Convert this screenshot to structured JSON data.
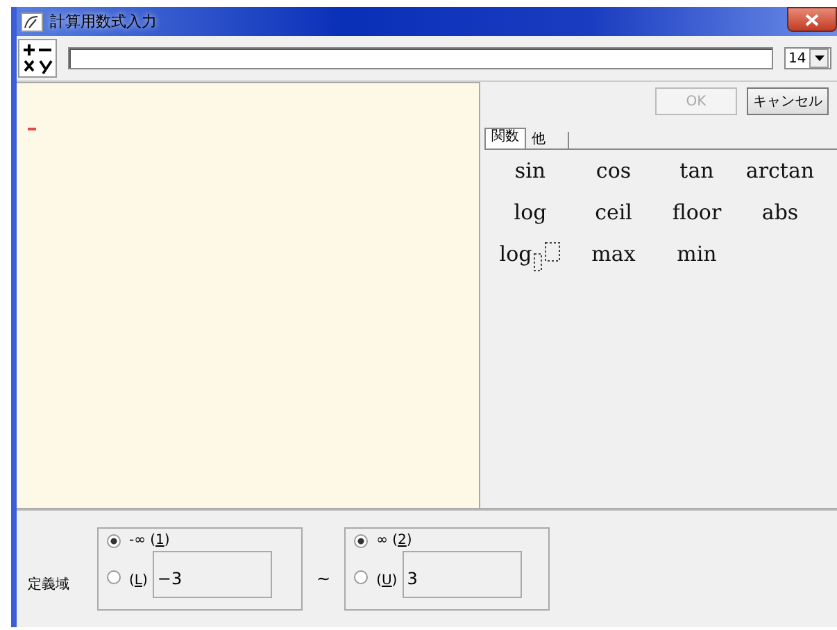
{
  "window": {
    "title": "計算用数式入力"
  },
  "toolbar": {
    "font_size": "14"
  },
  "buttons": [
    {
      "label": "OK",
      "disabled": true
    },
    {
      "label": "キャンセル",
      "disabled": false
    }
  ],
  "tabs": [
    {
      "label": "関数",
      "selected": true
    },
    {
      "label": "他",
      "selected": false
    }
  ],
  "functions": [
    {
      "label": "sin",
      "kind": "plain"
    },
    {
      "label": "cos",
      "kind": "plain"
    },
    {
      "label": "tan",
      "kind": "plain"
    },
    {
      "label": "arctan",
      "kind": "plain"
    },
    {
      "label": "log",
      "kind": "plain"
    },
    {
      "label": "ceil",
      "kind": "plain"
    },
    {
      "label": "floor",
      "kind": "plain"
    },
    {
      "label": "abs",
      "kind": "plain"
    },
    {
      "label": "log",
      "kind": "base"
    },
    {
      "label": "max",
      "kind": "plain"
    },
    {
      "label": "min",
      "kind": "plain"
    }
  ],
  "domain": {
    "label": "定義域",
    "separator": "~",
    "bounds": [
      {
        "options": [
          {
            "before": "-∞ (",
            "key": "1",
            "after": ")",
            "selected": true
          },
          {
            "before": "(",
            "key": "L",
            "after": ")",
            "selected": false,
            "value": "−3"
          }
        ]
      },
      {
        "options": [
          {
            "before": "∞ (",
            "key": "2",
            "after": ")",
            "selected": true
          },
          {
            "before": "(",
            "key": "U",
            "after": ")",
            "selected": false,
            "value": "3"
          }
        ]
      }
    ]
  }
}
